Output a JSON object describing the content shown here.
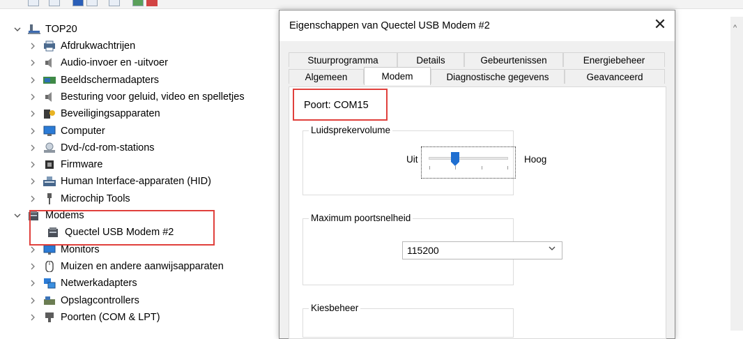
{
  "tree": {
    "root": {
      "label": "TOP20",
      "expanded": true
    },
    "items": [
      {
        "label": "Afdrukwachtrijen",
        "icon": "printer-queue-icon"
      },
      {
        "label": "Audio-invoer en -uitvoer",
        "icon": "speaker-icon"
      },
      {
        "label": "Beeldschermadapters",
        "icon": "display-adapter-icon"
      },
      {
        "label": "Besturing voor geluid, video en spelletjes",
        "icon": "speaker-icon"
      },
      {
        "label": "Beveiligingsapparaten",
        "icon": "security-device-icon"
      },
      {
        "label": "Computer",
        "icon": "computer-monitor-icon"
      },
      {
        "label": "Dvd-/cd-rom-stations",
        "icon": "dvd-drive-icon"
      },
      {
        "label": "Firmware",
        "icon": "firmware-chip-icon"
      },
      {
        "label": "Human Interface-apparaten (HID)",
        "icon": "hid-keyboard-icon"
      },
      {
        "label": "Microchip Tools",
        "icon": "usb-plug-icon"
      },
      {
        "label": "Modems",
        "icon": "modem-icon",
        "expanded": true
      },
      {
        "label": "Quectel USB Modem #2",
        "icon": "modem-icon",
        "child": true
      },
      {
        "label": "Monitors",
        "icon": "monitor-icon"
      },
      {
        "label": "Muizen en andere aanwijsapparaten",
        "icon": "mouse-icon"
      },
      {
        "label": "Netwerkadapters",
        "icon": "network-adapter-icon"
      },
      {
        "label": "Opslagcontrollers",
        "icon": "storage-controller-icon"
      },
      {
        "label": "Poorten (COM & LPT)",
        "icon": "port-icon"
      }
    ]
  },
  "dialog": {
    "title": "Eigenschappen van Quectel USB Modem #2",
    "close_glyph": "✕",
    "tabs_back": [
      "Stuurprogramma",
      "Details",
      "Gebeurtenissen",
      "Energiebeheer"
    ],
    "tabs_front": [
      "Algemeen",
      "Modem",
      "Diagnostische gegevens",
      "Geavanceerd"
    ],
    "active_tab": "Modem",
    "port_label": "Poort:",
    "port_value": "COM15",
    "speaker_group": {
      "title": "Luidsprekervolume",
      "low_label": "Uit",
      "high_label": "Hoog",
      "level": 0.33
    },
    "speed_group": {
      "title": "Maximum poortsnelheid",
      "selected": "115200"
    },
    "dial_group": {
      "title": "Kiesbeheer"
    }
  },
  "colors": {
    "highlight_box": "#e0403c",
    "slider_thumb": "#1f6fd1",
    "dialog_bg": "#f0f0f0"
  }
}
